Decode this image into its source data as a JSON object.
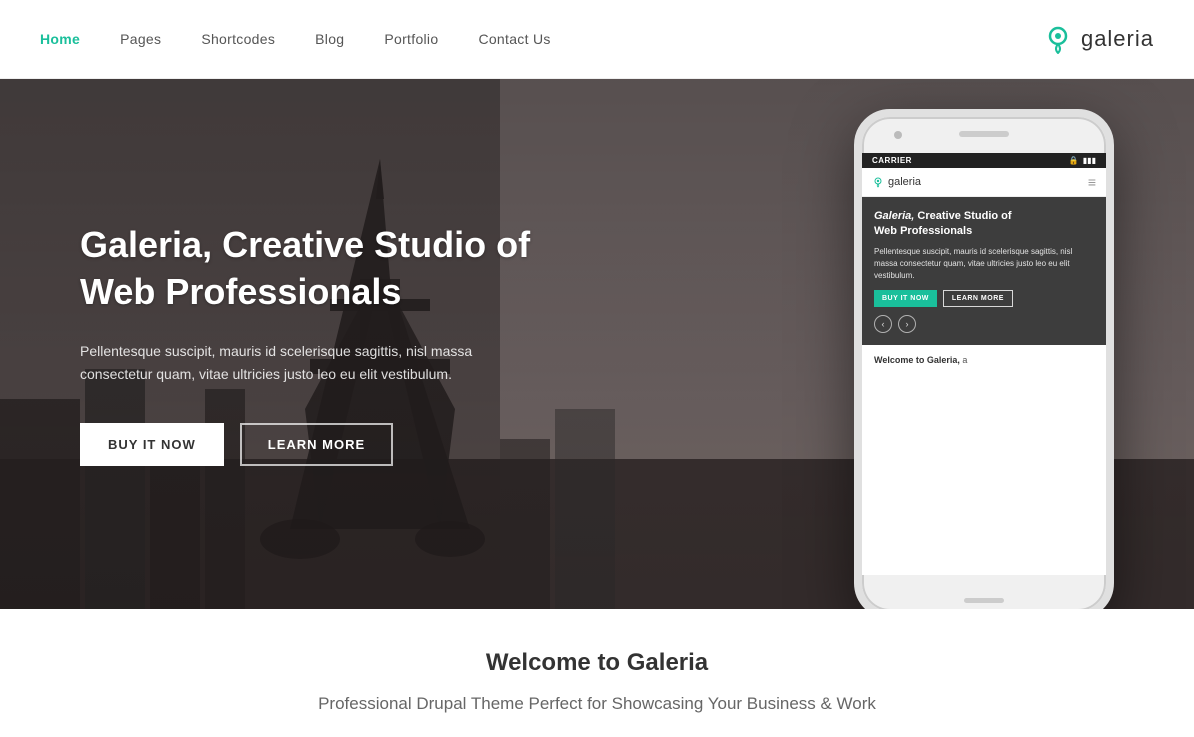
{
  "header": {
    "nav": {
      "items": [
        {
          "label": "Home",
          "active": true
        },
        {
          "label": "Pages",
          "active": false
        },
        {
          "label": "Shortcodes",
          "active": false
        },
        {
          "label": "Blog",
          "active": false
        },
        {
          "label": "Portfolio",
          "active": false
        },
        {
          "label": "Contact Us",
          "active": false
        }
      ]
    },
    "logo": {
      "text": "galeria",
      "icon": "location-pin-icon"
    }
  },
  "hero": {
    "title": "Galeria, Creative Studio of\nWeb Professionals",
    "subtitle": "Pellentesque suscipit, mauris id scelerisque sagittis, nisl massa consectetur quam, vitae ultricies justo leo eu elit vestibulum.",
    "btn_buy": "BUY IT NOW",
    "btn_learn": "LEARN MORE",
    "phone": {
      "status_bar": {
        "carrier": "CARRIER",
        "lock": "🔒",
        "battery": "▮▮▮"
      },
      "logo_text": "galeria",
      "menu_icon": "≡",
      "hero_title": "Galeria, Creative Studio of Web Professionals",
      "hero_body": "Pellentesque suscipit, mauris id scelerisque sagittis, nisl massa consectetur quam, vitae ultricies justo leo eu elit vestibulum.",
      "btn_buy": "BUY IT NOW",
      "btn_learn": "LEARN MORE",
      "arrow_left": "‹",
      "arrow_right": "›",
      "welcome_text": "Welcome to Galeria, a"
    }
  },
  "bottom": {
    "title": "Welcome to Galeria",
    "subtitle": "Professional Drupal Theme Perfect for Showcasing Your Business & Work"
  },
  "colors": {
    "accent": "#1abf9b",
    "nav_active": "#1abf9b",
    "text_dark": "#333333",
    "text_muted": "#666666"
  }
}
